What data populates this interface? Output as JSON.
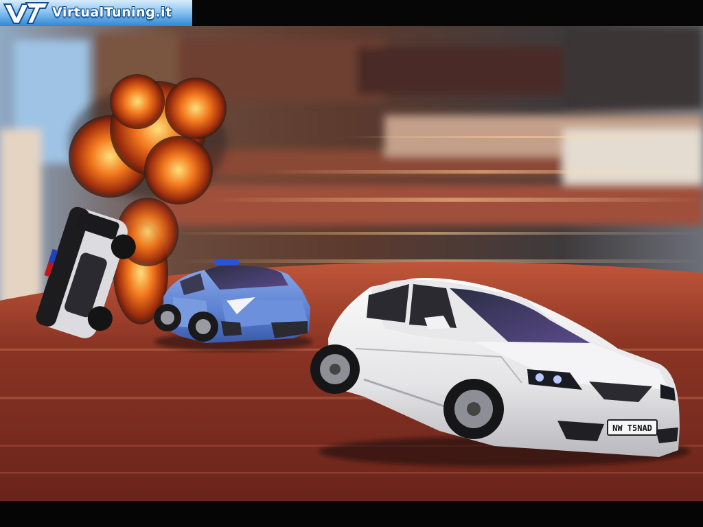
{
  "logo": {
    "text": "VirtualTuning.it"
  },
  "scene": {
    "plate_text": "NW T5NAD",
    "colors": {
      "background_blur": "#b85a3c",
      "road": "#7c2e20",
      "white_car": "#e8e8ea",
      "police_car": "#5f86d6",
      "fire": "#f06a14",
      "smoke": "#3a2a22"
    }
  }
}
